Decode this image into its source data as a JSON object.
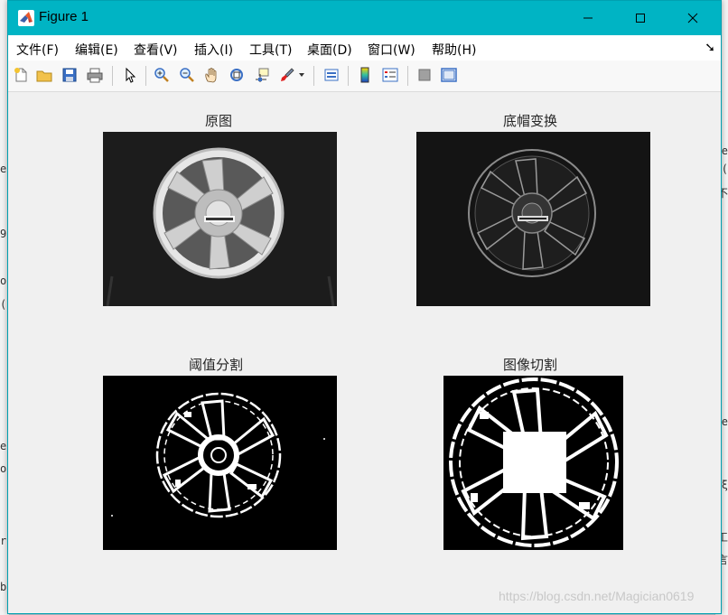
{
  "window": {
    "title": "Figure 1",
    "accent": "#00b4c4"
  },
  "menu": {
    "items": [
      {
        "label": "文件(F)"
      },
      {
        "label": "编辑(E)"
      },
      {
        "label": "查看(V)"
      },
      {
        "label": "插入(I)"
      },
      {
        "label": "工具(T)"
      },
      {
        "label": "桌面(D)"
      },
      {
        "label": "窗口(W)"
      },
      {
        "label": "帮助(H)"
      }
    ],
    "overflow_icon": "dock-arrow-icon"
  },
  "toolbar": {
    "buttons": [
      "new-figure-icon",
      "open-file-icon",
      "save-icon",
      "print-icon",
      "pointer-icon",
      "zoom-in-icon",
      "zoom-out-icon",
      "pan-hand-icon",
      "rotate-3d-icon",
      "data-cursor-icon",
      "brush-icon",
      "link-plot-icon",
      "colorbar-icon",
      "legend-icon",
      "hide-plot-tools-icon",
      "show-plot-tools-icon"
    ]
  },
  "subplots": [
    {
      "title": "原图",
      "image": "grayscale wheel photo"
    },
    {
      "title": "底帽变换",
      "image": "bottom-hat transformed wheel"
    },
    {
      "title": "阈值分割",
      "image": "binary thresholded wheel"
    },
    {
      "title": "图像切割",
      "image": "binary cropped wheel with square"
    }
  ],
  "watermark": "https://blog.csdn.net/Magician0619",
  "background_left": [
    "e",
    "9",
    "o",
    "(",
    "e",
    "o",
    "r",
    "b"
  ],
  "background_right": [
    "e",
    "(",
    "ξ",
    "不",
    "e",
    "工",
    "言"
  ]
}
